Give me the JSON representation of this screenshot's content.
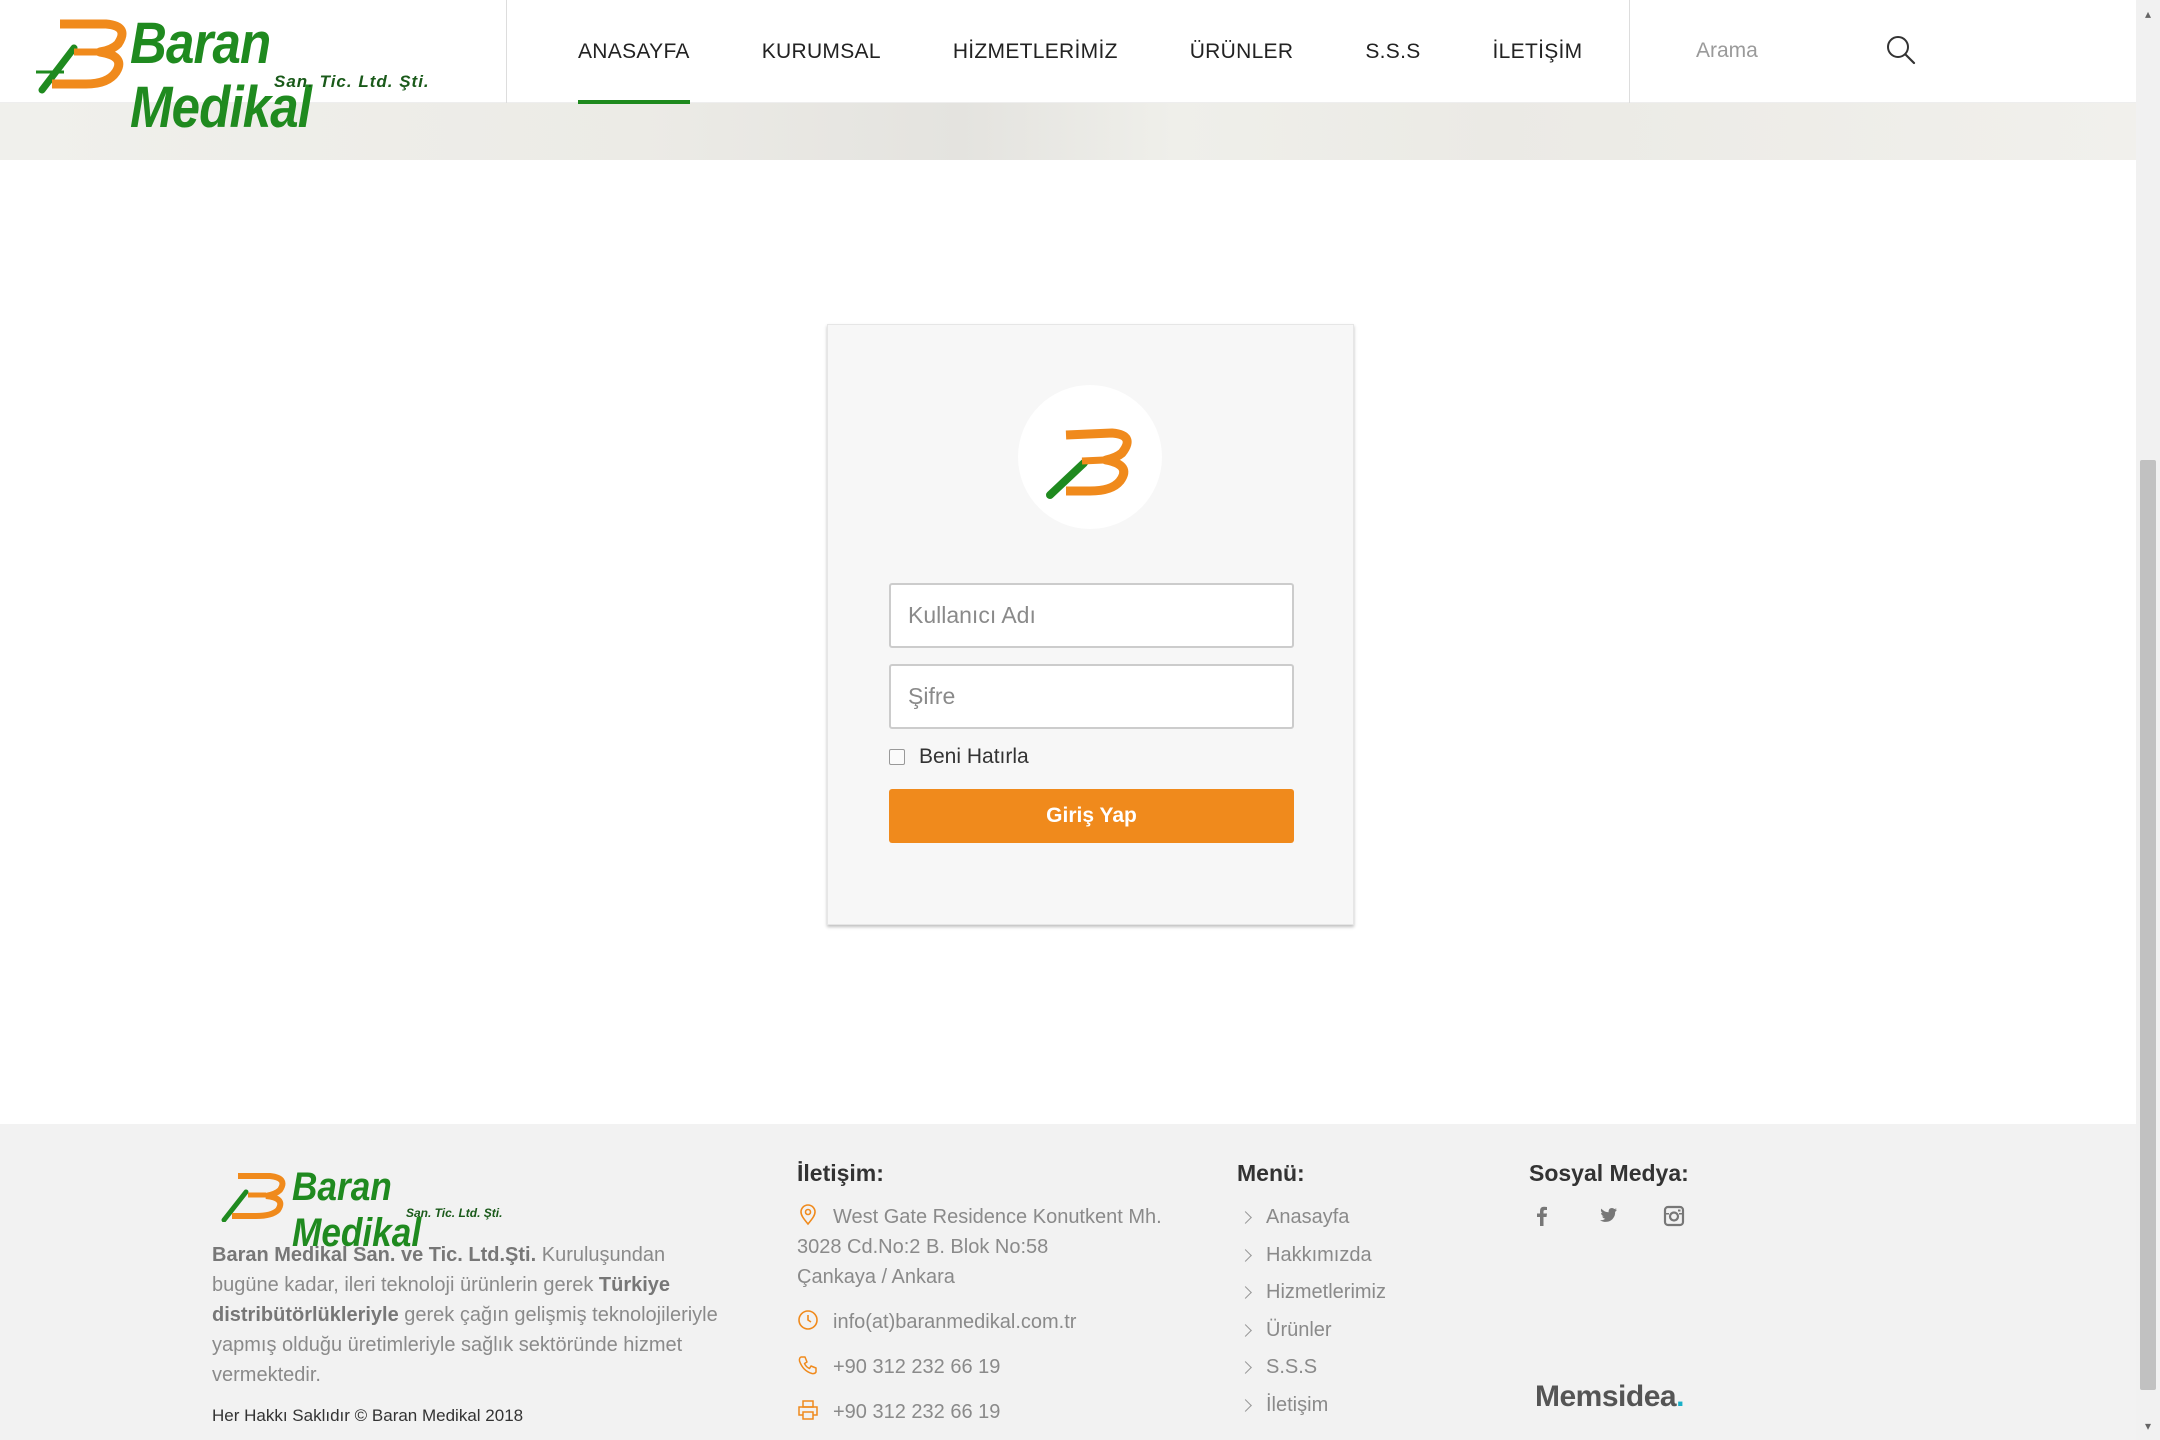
{
  "brand": {
    "name": "Baran Medikal",
    "subtitle": "San. Tic. Ltd. Şti.",
    "colors": {
      "green": "#1f8a1f",
      "orange": "#f08a1c"
    }
  },
  "nav": {
    "items": [
      {
        "label": "ANASAYFA",
        "active": true
      },
      {
        "label": "KURUMSAL"
      },
      {
        "label": "HİZMETLERİMİZ"
      },
      {
        "label": "ÜRÜNLER"
      },
      {
        "label": "S.S.S"
      },
      {
        "label": "İLETİŞİM"
      }
    ]
  },
  "search": {
    "placeholder": "Arama",
    "icon": "search-icon"
  },
  "login": {
    "username_placeholder": "Kullanıcı Adı",
    "password_placeholder": "Şifre",
    "remember_label": "Beni Hatırla",
    "submit_label": "Giriş Yap"
  },
  "footer": {
    "about_company": "Baran Medikal San. ve Tic. Ltd.Şti.",
    "about_text_1": " Kuruluşundan bugüne kadar, ileri teknoloji ürünlerin gerek ",
    "about_strong": "Türkiye distribütörlükleriyle",
    "about_text_2": " gerek çağın gelişmiş teknolojileriyle yapmış olduğu üretimleriyle sağlık sektöründe hizmet vermektedir.",
    "copyright": "Her Hakkı Saklıdır © Baran Medikal 2018",
    "contact": {
      "heading": "İletişim:",
      "address_line1": "West Gate Residence Konutkent Mh.",
      "address_line2": "3028 Cd.No:2 B. Blok No:58",
      "address_line3": "Çankaya / Ankara",
      "email": "info(at)baranmedikal.com.tr",
      "phone": "+90 312 232 66 19",
      "fax": "+90 312 232 66 19"
    },
    "menu": {
      "heading": "Menü:",
      "items": [
        "Anasayfa",
        "Hakkımızda",
        "Hizmetlerimiz",
        "Ürünler",
        "S.S.S",
        "İletişim"
      ]
    },
    "social": {
      "heading": "Sosyal Medya:",
      "icons": [
        "facebook-icon",
        "twitter-icon",
        "instagram-icon"
      ]
    },
    "credit": {
      "name": "Memsidea",
      "dot": "."
    }
  }
}
